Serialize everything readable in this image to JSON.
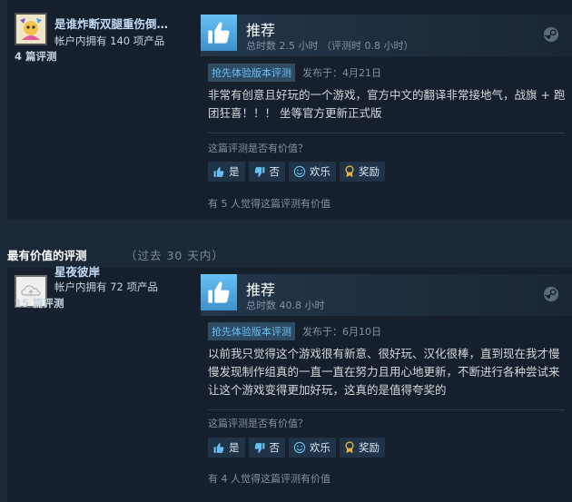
{
  "reviews": [
    {
      "author_name": "是谁炸断双腿重伤倒…",
      "author_products": "帐户内拥有 140 项产品",
      "author_reviews": "4 篇评测",
      "recommendation": "推荐",
      "hours": "总时数 2.5 小时  （评测时 0.8 小时）",
      "early_access_badge": "抢先体验版本评测",
      "posted": "发布于：4月21日",
      "text": "非常有创意且好玩的一个游戏，官方中文的翻译非常接地气，战旗 + 跑团狂喜！！！ 坐等官方更新正式版",
      "helpful_question": "这篇评测是否有价值？",
      "buttons": {
        "yes": "是",
        "no": "否",
        "funny": "欢乐",
        "award": "奖励"
      },
      "helpful_count": "有 5 人觉得这篇评测有价值"
    },
    {
      "author_name": "星夜彼岸",
      "author_products": "帐户内拥有 72 项产品",
      "author_reviews": "15 篇评测",
      "recommendation": "推荐",
      "hours": "总时数 40.8 小时",
      "early_access_badge": "抢先体验版本评测",
      "posted": "发布于：6月10日",
      "text": "以前我只觉得这个游戏很有新意、很好玩、汉化很棒，直到现在我才慢慢发现制作组真的一直一直在努力且用心地更新，不断进行各种尝试来让这个游戏变得更加好玩，这真的是值得夸奖的",
      "helpful_question": "这篇评测是否有价值？",
      "buttons": {
        "yes": "是",
        "no": "否",
        "funny": "欢乐",
        "award": "奖励"
      },
      "helpful_count": "有 4 人觉得这篇评测有价值"
    }
  ],
  "section": {
    "heading": "最有价值的评测",
    "subheading": "（过去 30 天内）"
  },
  "colors": {
    "background": "#1b2838",
    "card": "#16202d",
    "accent": "#67c1f5",
    "thumb": "#3f91c9",
    "award": "#e8b43a"
  },
  "icons": [
    "thumbs-up-icon",
    "thumbs-down-icon",
    "smile-icon",
    "award-icon",
    "steam-icon"
  ]
}
